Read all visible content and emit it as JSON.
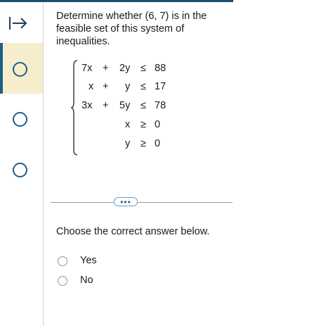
{
  "sidebar": {
    "questions": [
      {
        "label": "",
        "active": true
      },
      {
        "label": "",
        "active": false
      },
      {
        "label": "",
        "active": false
      }
    ]
  },
  "question": {
    "prompt": "Determine whether (6, 7) is in the feasible set of this system of inequalities.",
    "system": [
      {
        "lhs1": "7x",
        "op": "+",
        "lhs2": "2y",
        "rel": "≤",
        "rhs": "88"
      },
      {
        "lhs1": "x",
        "op": "+",
        "lhs2": "y",
        "rel": "≤",
        "rhs": "17"
      },
      {
        "lhs1": "3x",
        "op": "+",
        "lhs2": "5y",
        "rel": "≤",
        "rhs": "78"
      },
      {
        "lhs1": "",
        "op": "",
        "lhs2": "x",
        "rel": "≥",
        "rhs": "0"
      },
      {
        "lhs1": "",
        "op": "",
        "lhs2": "y",
        "rel": "≥",
        "rhs": "0"
      }
    ],
    "more_label": "•••",
    "instruction": "Choose the correct answer below.",
    "options": [
      "Yes",
      "No"
    ]
  },
  "colors": {
    "accent": "#1b4f72",
    "active_bg": "#f6edcc",
    "radio_border": "#7a9bb5"
  }
}
